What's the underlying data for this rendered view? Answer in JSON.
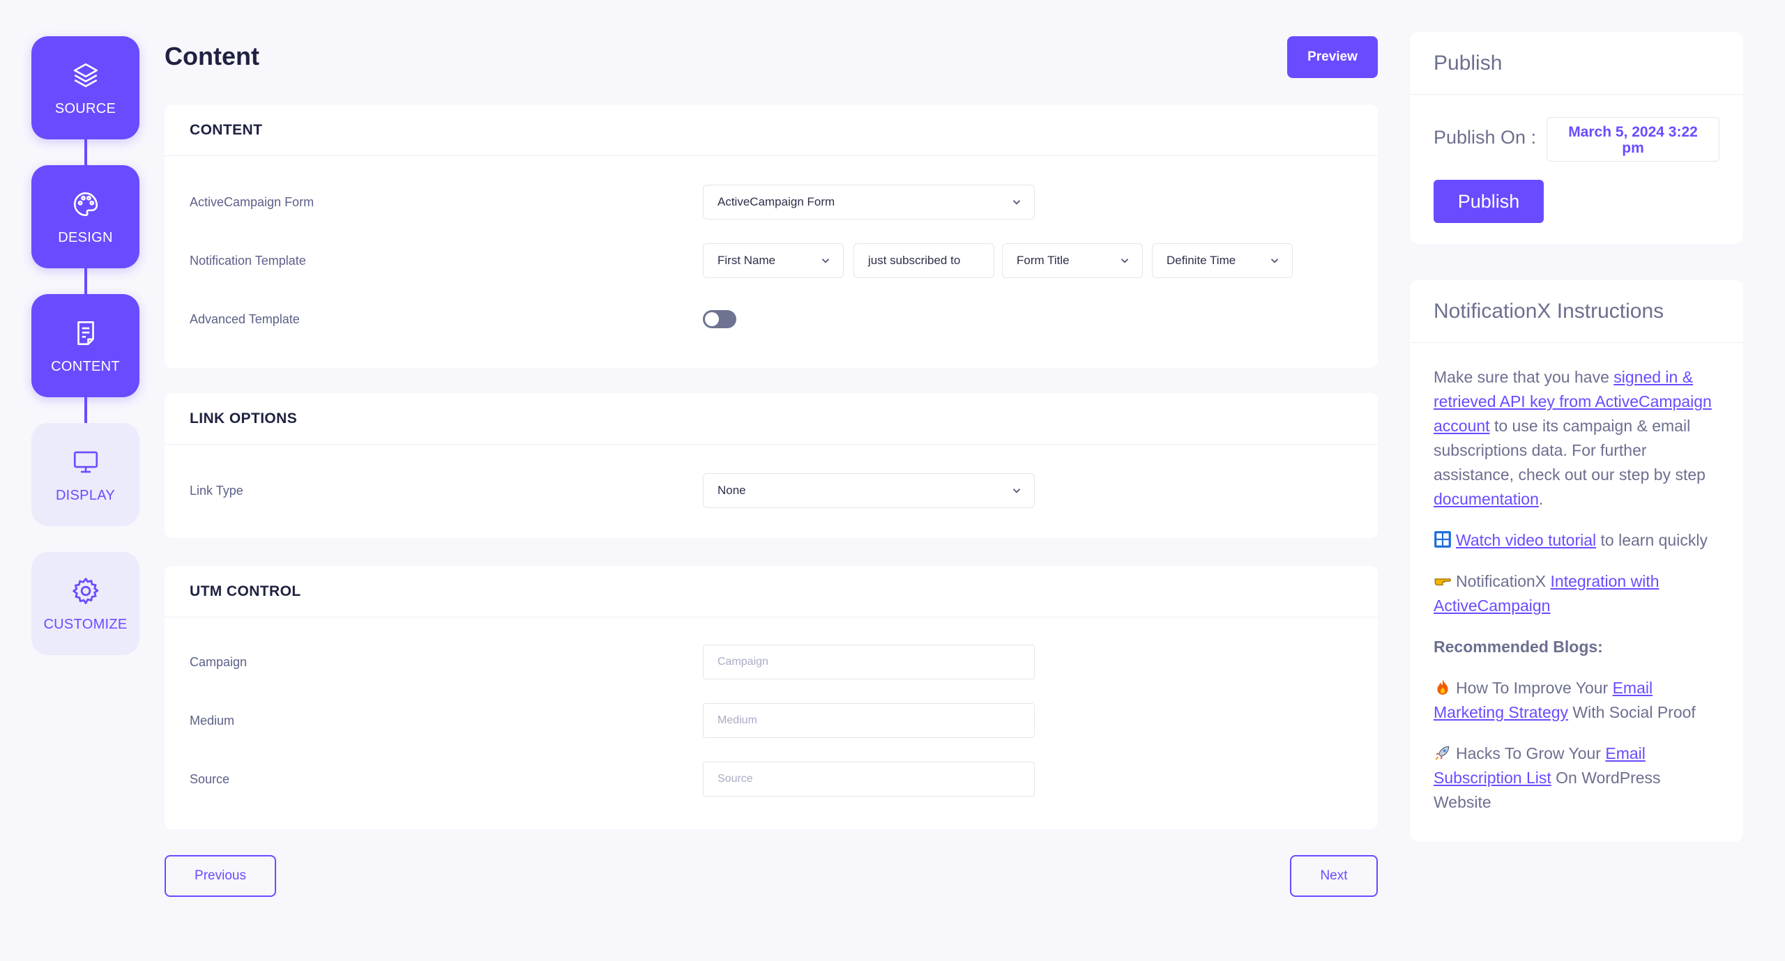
{
  "steps": [
    {
      "label": "SOURCE",
      "icon": "layers-icon",
      "state": "active"
    },
    {
      "label": "DESIGN",
      "icon": "palette-icon",
      "state": "active"
    },
    {
      "label": "CONTENT",
      "icon": "document-icon",
      "state": "active"
    },
    {
      "label": "DISPLAY",
      "icon": "monitor-icon",
      "state": "inactive"
    },
    {
      "label": "CUSTOMIZE",
      "icon": "gear-icon",
      "state": "inactive"
    }
  ],
  "page": {
    "title": "Content",
    "preview_label": "Preview"
  },
  "content_section": {
    "heading": "CONTENT",
    "form_label": "ActiveCampaign Form",
    "form_value": "ActiveCampaign Form",
    "template_label": "Notification Template",
    "template": {
      "field1": "First Name",
      "text": "just subscribed to",
      "field2": "Form Title",
      "field3": "Definite Time"
    },
    "advanced_label": "Advanced Template",
    "advanced_enabled": false
  },
  "link_section": {
    "heading": "LINK OPTIONS",
    "link_type_label": "Link Type",
    "link_type_value": "None"
  },
  "utm_section": {
    "heading": "UTM CONTROL",
    "campaign_label": "Campaign",
    "campaign_placeholder": "Campaign",
    "medium_label": "Medium",
    "medium_placeholder": "Medium",
    "source_label": "Source",
    "source_placeholder": "Source"
  },
  "nav": {
    "previous_label": "Previous",
    "next_label": "Next"
  },
  "publish": {
    "heading": "Publish",
    "publish_on_label": "Publish On :",
    "date_line1": "March 5, 2024 3:22",
    "date_line2": "pm",
    "button_label": "Publish"
  },
  "instructions": {
    "heading": "NotificationX Instructions",
    "p1_pre": "Make sure that you have ",
    "p1_link1": "signed in & retrieved API key from ActiveCampaign account",
    "p1_mid": " to use its campaign & email subscriptions data. For further assistance, check out our step by step ",
    "p1_link2": "documentation",
    "p1_end": ".",
    "video_link": "Watch video tutorial",
    "video_post": " to learn quickly",
    "integration_pre": "NotificationX ",
    "integration_link": "Integration with ActiveCampaign",
    "blogs_heading": "Recommended Blogs:",
    "blog1_pre": "How To Improve Your ",
    "blog1_link": "Email Marketing Strategy",
    "blog1_post": " With Social Proof",
    "blog2_pre": "Hacks To Grow Your ",
    "blog2_link": "Email Subscription List",
    "blog2_post": " On WordPress Website"
  },
  "colors": {
    "accent": "#6a4bff",
    "background": "#f7f7fc",
    "inactive_step": "#ecebfb"
  }
}
